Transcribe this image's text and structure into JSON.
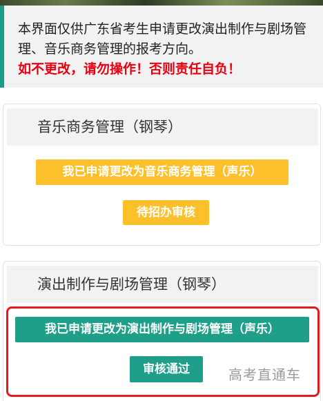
{
  "notice": {
    "line1": "本界面仅供广东省考生申请更改演出制作与剧场管理、音乐商务管理的报考方向。",
    "warning": "如不更改，请勿操作！否则责任自负！"
  },
  "card_music": {
    "title": "音乐商务管理（钢琴）",
    "apply_button": "我已申请更改为音乐商务管理（声乐）",
    "status_button": "待招办审核"
  },
  "card_performance": {
    "title": "演出制作与剧场管理（钢琴）",
    "apply_button": "我已申请更改为演出制作与剧场管理（声乐）",
    "status_button": "审核通过"
  },
  "watermark": "高考直通车",
  "colors": {
    "accent_teal": "#1f9e89",
    "accent_yellow": "#fcc02a",
    "warning_red": "#e60012",
    "highlight_red": "#e21b1b"
  }
}
